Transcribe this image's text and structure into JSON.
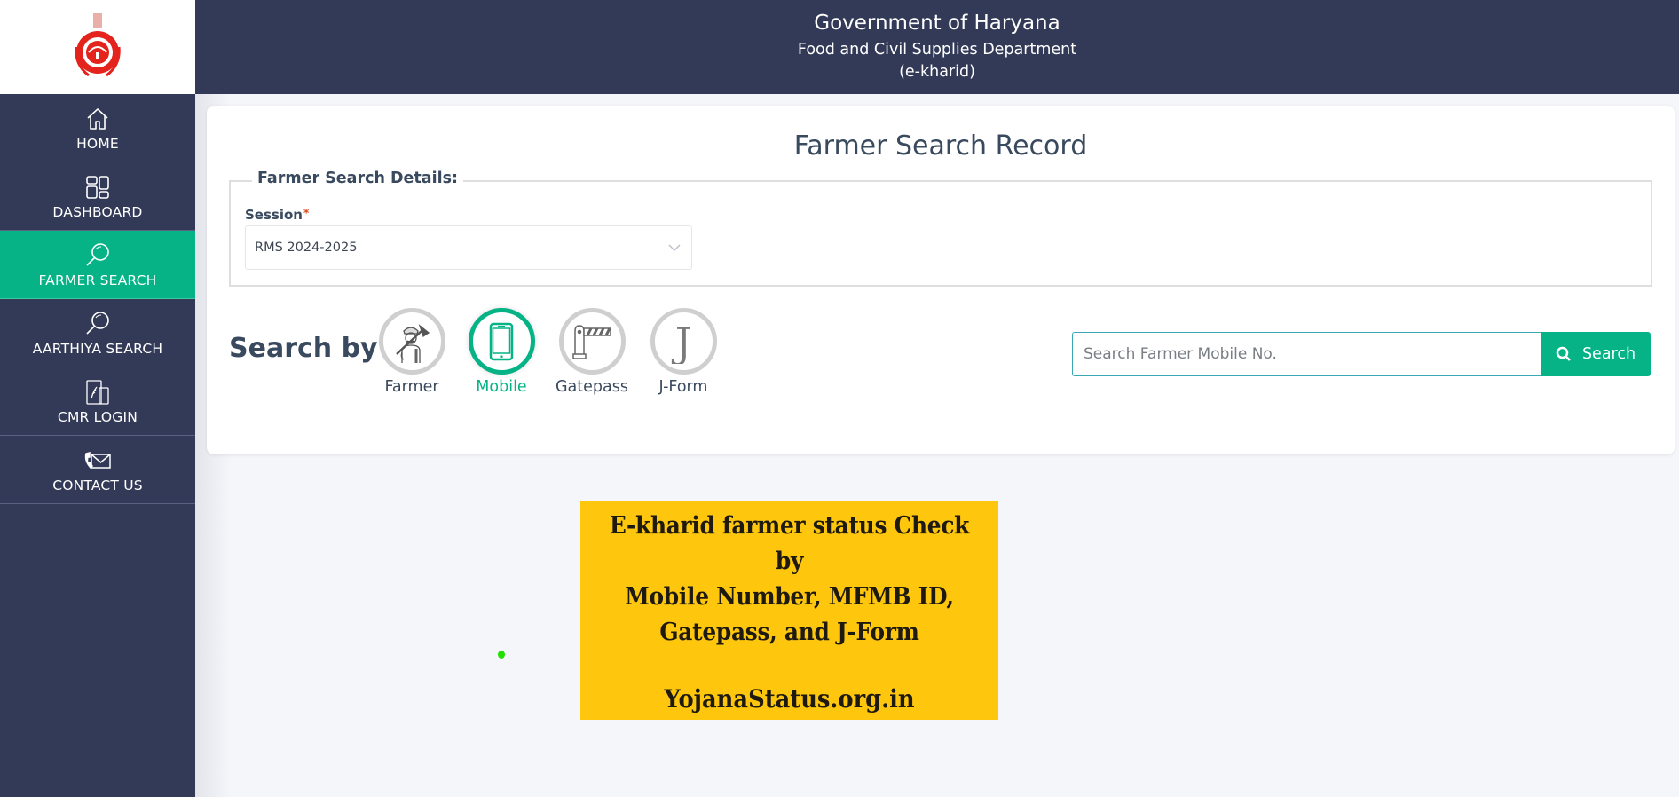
{
  "header": {
    "line1": "Government of Haryana",
    "line2": "Food and Civil Supplies Department",
    "line3": "(e-kharid)"
  },
  "logo": {
    "icon": "haryana-emblem-icon"
  },
  "sidebar": {
    "items": [
      {
        "label": "HOME",
        "icon": "home-icon",
        "active": false
      },
      {
        "label": "DASHBOARD",
        "icon": "dashboard-icon",
        "active": false
      },
      {
        "label": "FARMER SEARCH",
        "icon": "search-icon",
        "active": true
      },
      {
        "label": "AARTHIYA SEARCH",
        "icon": "search-icon",
        "active": false
      },
      {
        "label": "CMR LOGIN",
        "icon": "cmr-login-icon",
        "active": false
      },
      {
        "label": "CONTACT US",
        "icon": "contact-icon",
        "active": false
      }
    ]
  },
  "main": {
    "title": "Farmer Search Record",
    "fieldset_legend": "Farmer Search Details:",
    "session": {
      "label": "Session",
      "required_mark": "*",
      "value": "RMS 2024-2025"
    },
    "search_by": {
      "label": "Search by",
      "options": [
        {
          "label": "Farmer",
          "icon": "farmer-icon",
          "active": false
        },
        {
          "label": "Mobile",
          "icon": "mobile-icon",
          "active": true
        },
        {
          "label": "Gatepass",
          "icon": "gatepass-icon",
          "active": false
        },
        {
          "label": "J-Form",
          "icon": "jform-icon",
          "active": false
        }
      ]
    },
    "search": {
      "placeholder": "Search Farmer Mobile No.",
      "value": "",
      "button_label": "Search"
    }
  },
  "banner": {
    "line1": "E-kharid farmer status Check by",
    "line2": "Mobile Number, MFMB ID,",
    "line3": "Gatepass, and J-Form",
    "line4": "YojanaStatus.org.in"
  },
  "colors": {
    "sidebar_bg": "#333a57",
    "accent": "#05b386",
    "banner_bg": "#fec70d",
    "text_dark": "#3a4a5e"
  }
}
